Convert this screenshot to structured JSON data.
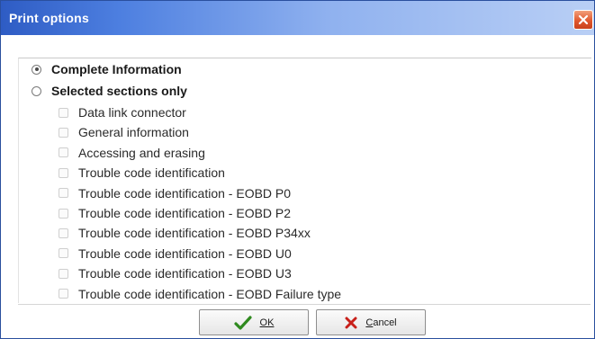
{
  "window": {
    "title": "Print options",
    "close_icon": "close-icon"
  },
  "options": {
    "complete_label": "Complete Information",
    "complete_selected": true,
    "selected_label": "Selected sections only",
    "selected_selected": false
  },
  "sections": [
    {
      "label": "Data link connector",
      "checked": false
    },
    {
      "label": "General information",
      "checked": false
    },
    {
      "label": "Accessing and erasing",
      "checked": false
    },
    {
      "label": "Trouble code identification",
      "checked": false
    },
    {
      "label": "Trouble code identification - EOBD P0",
      "checked": false
    },
    {
      "label": "Trouble code identification - EOBD P2",
      "checked": false
    },
    {
      "label": "Trouble code identification - EOBD P34xx",
      "checked": false
    },
    {
      "label": "Trouble code identification - EOBD U0",
      "checked": false
    },
    {
      "label": "Trouble code identification - EOBD U3",
      "checked": false
    },
    {
      "label": "Trouble code identification - EOBD Failure type",
      "checked": false
    }
  ],
  "buttons": {
    "ok_label": "OK",
    "ok_icon": "checkmark-icon",
    "cancel_label": "Cancel",
    "cancel_icon": "x-icon"
  },
  "colors": {
    "title_bar": "#2e5cc4",
    "close_button": "#e0582e",
    "ok_check": "#2f8a1f",
    "cancel_x": "#c8201a"
  }
}
